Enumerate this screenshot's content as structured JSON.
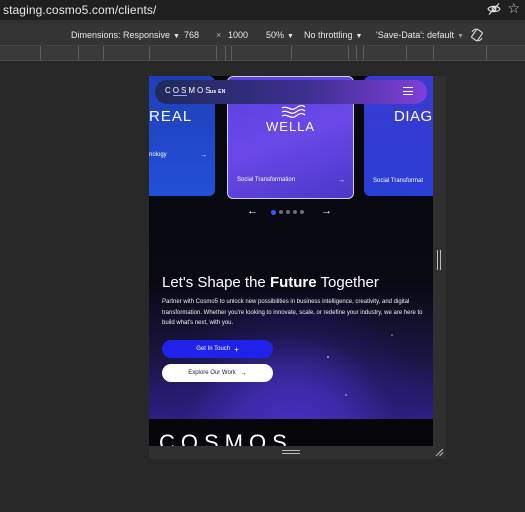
{
  "browser": {
    "url": "staging.cosmo5.com/clients/",
    "icons": {
      "visibility": "eye-off-icon",
      "bookmark": "star-icon"
    }
  },
  "device_toolbar": {
    "dimensions_label": "Dimensions: Responsive",
    "width": "768",
    "times": "×",
    "height": "1000",
    "zoom": "50%",
    "throttling": "No throttling",
    "save_data": "'Save-Data': default",
    "icons": {
      "rotate": "rotate-icon",
      "dropdown": "caret-down-icon"
    }
  },
  "site": {
    "nav": {
      "logo": "COSMOS",
      "language": "us EN",
      "icons": {
        "menu": "hamburger-menu-icon"
      }
    },
    "clients_carousel": {
      "cards": [
        {
          "brand": "L'OREAL",
          "brand_visible": "REAL",
          "label": "Technology",
          "label_visible": "nology",
          "arrow": "→"
        },
        {
          "brand": "WELLA",
          "label": "Social Transformation",
          "arrow": "→"
        },
        {
          "brand": "DIAGEO",
          "brand_visible": "DIAG",
          "label": "Social Transformation",
          "label_visible": "Social Transformat"
        }
      ],
      "prev_arrow": "←",
      "next_arrow": "→",
      "dot_count": 5,
      "active_dot": 0
    },
    "hero": {
      "headline_start": "Let's Shape the ",
      "headline_bold": "Future",
      "headline_end": " Together",
      "description": "Partner with Cosmo5 to unlock new possibilities in business intelligence, creativity, and digital transformation. Whether you're looking to innovate, scale, or redefine your industry, we are here to build what's next, with you.",
      "primary_button": "Get In Touch",
      "primary_icon": "+",
      "secondary_button": "Explore Our Work",
      "secondary_icon": "→"
    },
    "footer_logo": "COSMOS"
  },
  "colors": {
    "accent_blue": "#1e22ea",
    "card_purple": "#6a49e8",
    "page_dark": "#07070d",
    "devtools_bg": "#282828"
  }
}
